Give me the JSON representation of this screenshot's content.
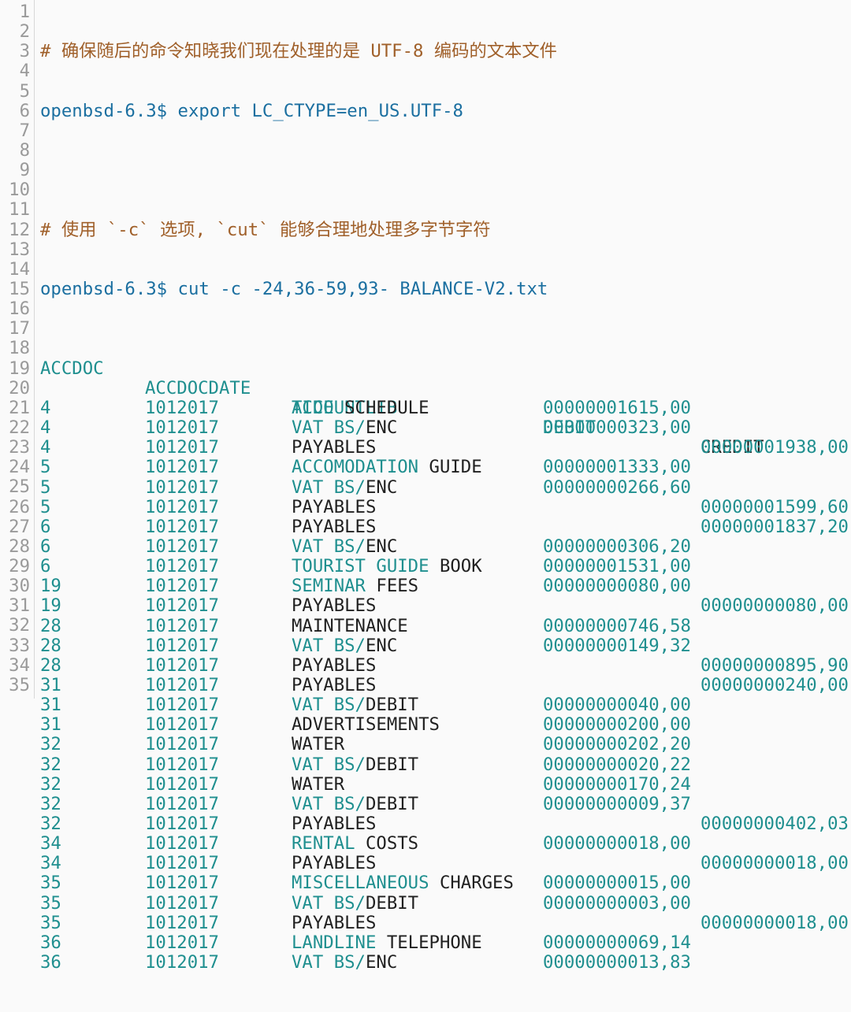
{
  "gutter": {
    "line_numbers": [
      "1",
      "2",
      "3",
      "4",
      "5",
      "6",
      "7",
      "8",
      "9",
      "10",
      "11",
      "12",
      "13",
      "14",
      "15",
      "16",
      "17",
      "18",
      "19",
      "20",
      "21",
      "22",
      "23",
      "24",
      "25",
      "26",
      "27",
      "28",
      "29",
      "30",
      "31",
      "32",
      "33",
      "34",
      "35"
    ]
  },
  "header": {
    "comment1": "# 确保随后的命令知晓我们现在处理的是 UTF-8 编码的文本文件",
    "cmd1_prompt": "openbsd-6.3$",
    "cmd1": " export LC_CTYPE=en_US.UTF-8",
    "comment2": "# 使用 `-c` 选项, `cut` 能够合理地处理多字节字符",
    "cmd2_prompt": "openbsd-6.3$",
    "cmd2": " cut -c -24,36-59,93- BALANCE-V2.txt"
  },
  "table": {
    "columns": [
      "ACCDOC",
      "ACCDOCDATE",
      "ACCOUNTLIB",
      "DEBIT",
      "CREDIT"
    ],
    "rows": [
      {
        "doc": "4",
        "date": "1012017",
        "lib_a": "TIDE",
        "lib_b": " SCHEDULE",
        "debit": "00000001615,00",
        "credit": ""
      },
      {
        "doc": "4",
        "date": "1012017",
        "lib_a": "VAT BS/",
        "lib_b": "ENC",
        "debit": "00000000323,00",
        "credit": ""
      },
      {
        "doc": "4",
        "date": "1012017",
        "lib_a": "",
        "lib_b": "PAYABLES",
        "debit": "",
        "credit": "00000001938,00"
      },
      {
        "doc": "5",
        "date": "1012017",
        "lib_a": "ACCOMODATION",
        "lib_b": " GUIDE",
        "debit": "00000001333,00",
        "credit": ""
      },
      {
        "doc": "5",
        "date": "1012017",
        "lib_a": "VAT BS/",
        "lib_b": "ENC",
        "debit": "00000000266,60",
        "credit": ""
      },
      {
        "doc": "5",
        "date": "1012017",
        "lib_a": "",
        "lib_b": "PAYABLES",
        "debit": "",
        "credit": "00000001599,60"
      },
      {
        "doc": "6",
        "date": "1012017",
        "lib_a": "",
        "lib_b": "PAYABLES",
        "debit": "",
        "credit": "00000001837,20"
      },
      {
        "doc": "6",
        "date": "1012017",
        "lib_a": "VAT BS/",
        "lib_b": "ENC",
        "debit": "00000000306,20",
        "credit": ""
      },
      {
        "doc": "6",
        "date": "1012017",
        "lib_a": "TOURIST GUIDE",
        "lib_b": " BOOK",
        "debit": "00000001531,00",
        "credit": ""
      },
      {
        "doc": "19",
        "date": "1012017",
        "lib_a": "SEMINAR",
        "lib_b": " FEES",
        "debit": "00000000080,00",
        "credit": ""
      },
      {
        "doc": "19",
        "date": "1012017",
        "lib_a": "",
        "lib_b": "PAYABLES",
        "debit": "",
        "credit": "00000000080,00"
      },
      {
        "doc": "28",
        "date": "1012017",
        "lib_a": "",
        "lib_b": "MAINTENANCE",
        "debit": "00000000746,58",
        "credit": ""
      },
      {
        "doc": "28",
        "date": "1012017",
        "lib_a": "VAT BS/",
        "lib_b": "ENC",
        "debit": "00000000149,32",
        "credit": ""
      },
      {
        "doc": "28",
        "date": "1012017",
        "lib_a": "",
        "lib_b": "PAYABLES",
        "debit": "",
        "credit": "00000000895,90"
      },
      {
        "doc": "31",
        "date": "1012017",
        "lib_a": "",
        "lib_b": "PAYABLES",
        "debit": "",
        "credit": "00000000240,00"
      },
      {
        "doc": "31",
        "date": "1012017",
        "lib_a": "VAT BS/",
        "lib_b": "DEBIT",
        "debit": "00000000040,00",
        "credit": ""
      },
      {
        "doc": "31",
        "date": "1012017",
        "lib_a": "",
        "lib_b": "ADVERTISEMENTS",
        "debit": "00000000200,00",
        "credit": ""
      },
      {
        "doc": "32",
        "date": "1012017",
        "lib_a": "",
        "lib_b": "WATER",
        "debit": "00000000202,20",
        "credit": ""
      },
      {
        "doc": "32",
        "date": "1012017",
        "lib_a": "VAT BS/",
        "lib_b": "DEBIT",
        "debit": "00000000020,22",
        "credit": ""
      },
      {
        "doc": "32",
        "date": "1012017",
        "lib_a": "",
        "lib_b": "WATER",
        "debit": "00000000170,24",
        "credit": ""
      },
      {
        "doc": "32",
        "date": "1012017",
        "lib_a": "VAT BS/",
        "lib_b": "DEBIT",
        "debit": "00000000009,37",
        "credit": ""
      },
      {
        "doc": "32",
        "date": "1012017",
        "lib_a": "",
        "lib_b": "PAYABLES",
        "debit": "",
        "credit": "00000000402,03"
      },
      {
        "doc": "34",
        "date": "1012017",
        "lib_a": "RENTAL",
        "lib_b": " COSTS",
        "debit": "00000000018,00",
        "credit": ""
      },
      {
        "doc": "34",
        "date": "1012017",
        "lib_a": "",
        "lib_b": "PAYABLES",
        "debit": "",
        "credit": "00000000018,00"
      },
      {
        "doc": "35",
        "date": "1012017",
        "lib_a": "MISCELLANEOUS",
        "lib_b": " CHARGES",
        "debit": "00000000015,00",
        "credit": ""
      },
      {
        "doc": "35",
        "date": "1012017",
        "lib_a": "VAT BS/",
        "lib_b": "DEBIT",
        "debit": "00000000003,00",
        "credit": ""
      },
      {
        "doc": "35",
        "date": "1012017",
        "lib_a": "",
        "lib_b": "PAYABLES",
        "debit": "",
        "credit": "00000000018,00"
      },
      {
        "doc": "36",
        "date": "1012017",
        "lib_a": "LANDLINE",
        "lib_b": " TELEPHONE",
        "debit": "00000000069,14",
        "credit": ""
      },
      {
        "doc": "36",
        "date": "1012017",
        "lib_a": "VAT BS/",
        "lib_b": "ENC",
        "debit": "00000000013,83",
        "credit": ""
      }
    ]
  },
  "colors": {
    "comment": "#a0602a",
    "prompt": "#1b6fa0",
    "teal": "#1f8f8f",
    "plain": "#202020",
    "gutter": "#9a9a9a",
    "background": "#fafafa"
  }
}
